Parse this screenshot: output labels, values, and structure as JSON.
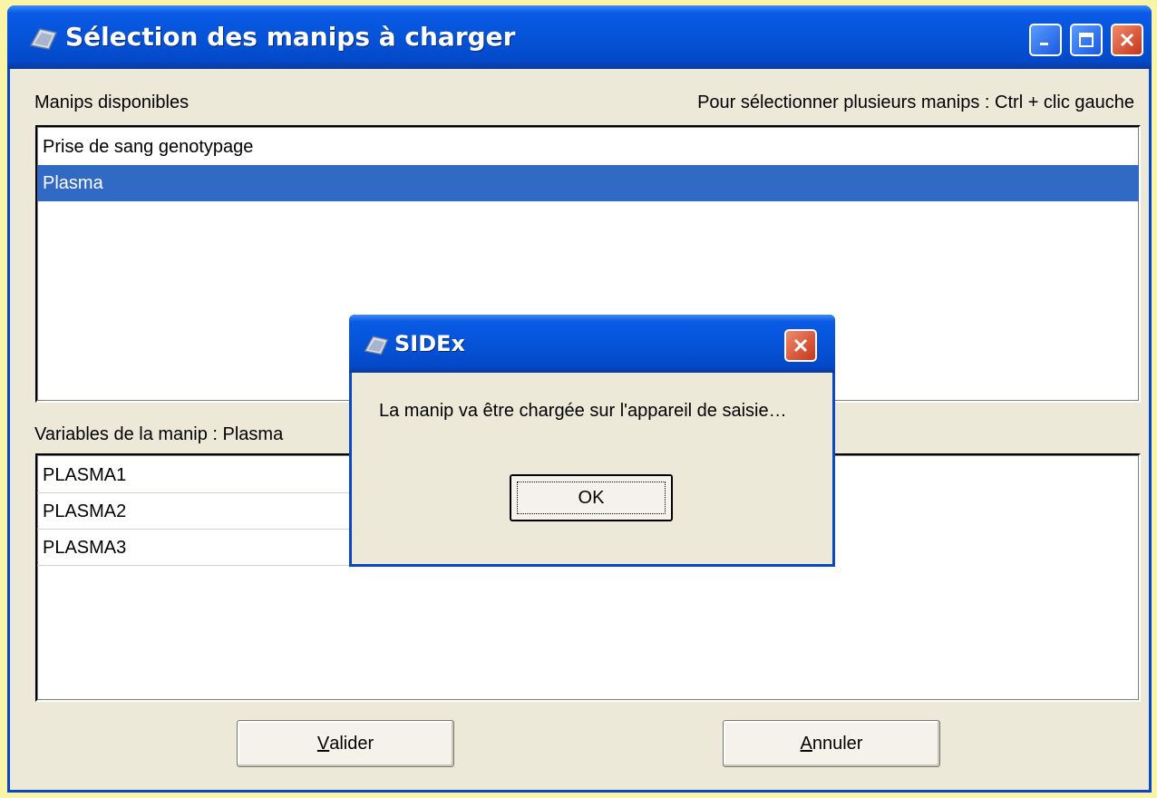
{
  "window": {
    "title": "Sélection des manips à charger",
    "minimize_icon": "minimize-icon",
    "maximize_icon": "maximize-icon",
    "close_icon": "close-icon"
  },
  "available": {
    "label": "Manips disponibles",
    "hint": "Pour sélectionner plusieurs manips : Ctrl + clic gauche",
    "items": [
      {
        "label": "Prise de sang genotypage",
        "selected": false
      },
      {
        "label": "Plasma",
        "selected": true
      }
    ]
  },
  "variables": {
    "label": "Variables de la manip : Plasma",
    "items": [
      "PLASMA1",
      "PLASMA2",
      "PLASMA3"
    ]
  },
  "buttons": {
    "validate_mnemonic": "V",
    "validate_rest": "alider",
    "cancel_mnemonic": "A",
    "cancel_rest": "nnuler"
  },
  "dialog": {
    "title": "SIDEx",
    "message": "La manip va être chargée sur l'appareil de saisie…",
    "ok_label": "OK"
  },
  "colors": {
    "titlebar": "#0653d8",
    "selection": "#316ac5",
    "window_bg": "#ece9d8",
    "close": "#c8351a"
  }
}
